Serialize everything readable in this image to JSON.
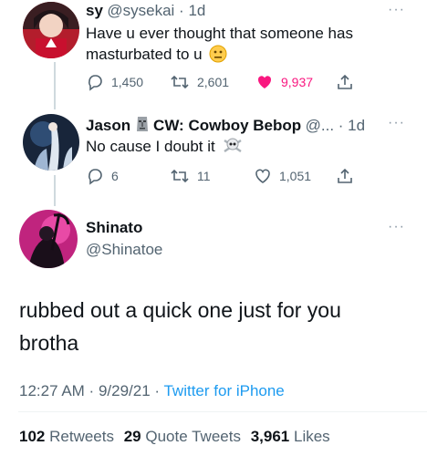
{
  "tweet1": {
    "display_name": "sy",
    "handle": "@sysekai",
    "time": "1d",
    "line1": "Have u ever thought that someone has",
    "line2": "masturbated to u",
    "replies": "1,450",
    "retweets": "2,601",
    "likes": "9,937",
    "like_color": "#f91880"
  },
  "tweet2": {
    "display_name": "Jason",
    "name_rest": "CW: Cowboy Bebop",
    "handle": "@...",
    "time": "1d",
    "text": "No cause I doubt it",
    "replies": "6",
    "retweets": "11",
    "likes": "1,051"
  },
  "main": {
    "display_name": "Shinato",
    "handle": "@Shinatoe",
    "line1": "rubbed out a quick one just for you",
    "line2": "brotha",
    "time": "12:27 AM",
    "date": "9/29/21",
    "source": "Twitter for iPhone",
    "retweets_count": "102",
    "retweets_label": "Retweets",
    "quotes_count": "29",
    "quotes_label": "Quote Tweets",
    "likes_count": "3,961",
    "likes_label": "Likes"
  },
  "colors": {
    "link": "#1d9bf0",
    "muted": "#536471"
  }
}
